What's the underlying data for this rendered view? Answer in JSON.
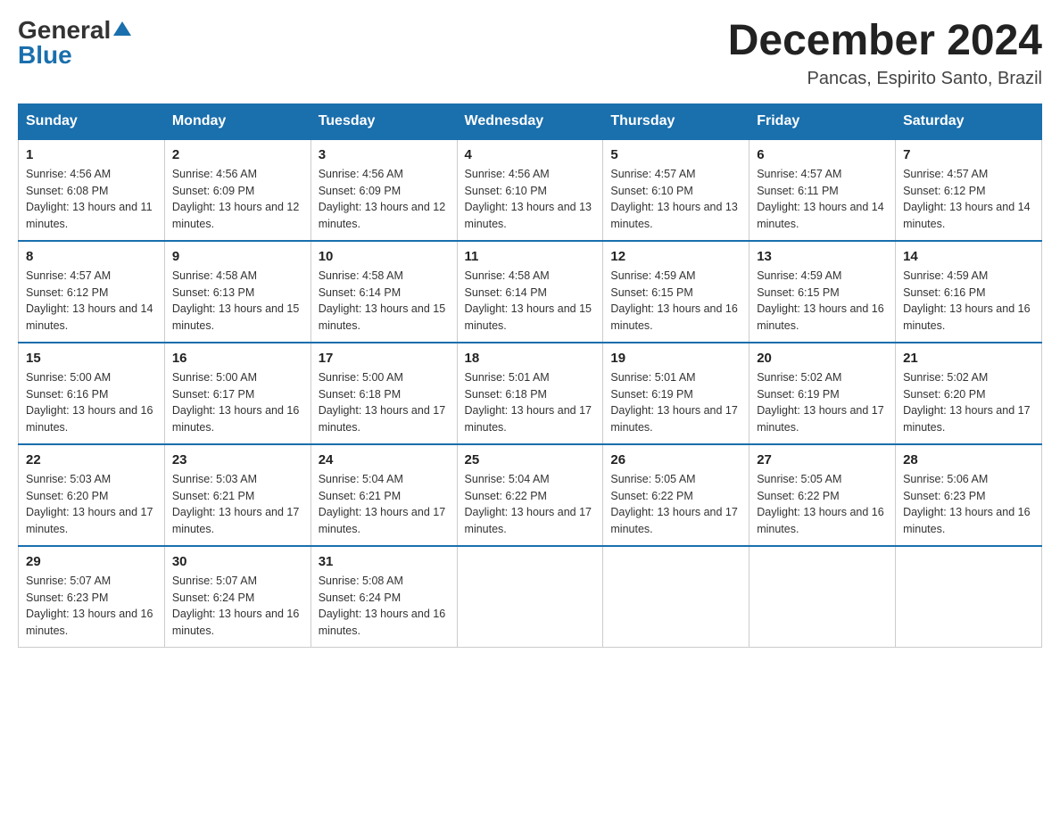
{
  "logo": {
    "general": "General",
    "triangle": "▲",
    "blue": "Blue"
  },
  "title": "December 2024",
  "subtitle": "Pancas, Espirito Santo, Brazil",
  "weekdays": [
    "Sunday",
    "Monday",
    "Tuesday",
    "Wednesday",
    "Thursday",
    "Friday",
    "Saturday"
  ],
  "weeks": [
    [
      {
        "day": "1",
        "sunrise": "4:56 AM",
        "sunset": "6:08 PM",
        "daylight": "13 hours and 11 minutes."
      },
      {
        "day": "2",
        "sunrise": "4:56 AM",
        "sunset": "6:09 PM",
        "daylight": "13 hours and 12 minutes."
      },
      {
        "day": "3",
        "sunrise": "4:56 AM",
        "sunset": "6:09 PM",
        "daylight": "13 hours and 12 minutes."
      },
      {
        "day": "4",
        "sunrise": "4:56 AM",
        "sunset": "6:10 PM",
        "daylight": "13 hours and 13 minutes."
      },
      {
        "day": "5",
        "sunrise": "4:57 AM",
        "sunset": "6:10 PM",
        "daylight": "13 hours and 13 minutes."
      },
      {
        "day": "6",
        "sunrise": "4:57 AM",
        "sunset": "6:11 PM",
        "daylight": "13 hours and 14 minutes."
      },
      {
        "day": "7",
        "sunrise": "4:57 AM",
        "sunset": "6:12 PM",
        "daylight": "13 hours and 14 minutes."
      }
    ],
    [
      {
        "day": "8",
        "sunrise": "4:57 AM",
        "sunset": "6:12 PM",
        "daylight": "13 hours and 14 minutes."
      },
      {
        "day": "9",
        "sunrise": "4:58 AM",
        "sunset": "6:13 PM",
        "daylight": "13 hours and 15 minutes."
      },
      {
        "day": "10",
        "sunrise": "4:58 AM",
        "sunset": "6:14 PM",
        "daylight": "13 hours and 15 minutes."
      },
      {
        "day": "11",
        "sunrise": "4:58 AM",
        "sunset": "6:14 PM",
        "daylight": "13 hours and 15 minutes."
      },
      {
        "day": "12",
        "sunrise": "4:59 AM",
        "sunset": "6:15 PM",
        "daylight": "13 hours and 16 minutes."
      },
      {
        "day": "13",
        "sunrise": "4:59 AM",
        "sunset": "6:15 PM",
        "daylight": "13 hours and 16 minutes."
      },
      {
        "day": "14",
        "sunrise": "4:59 AM",
        "sunset": "6:16 PM",
        "daylight": "13 hours and 16 minutes."
      }
    ],
    [
      {
        "day": "15",
        "sunrise": "5:00 AM",
        "sunset": "6:16 PM",
        "daylight": "13 hours and 16 minutes."
      },
      {
        "day": "16",
        "sunrise": "5:00 AM",
        "sunset": "6:17 PM",
        "daylight": "13 hours and 16 minutes."
      },
      {
        "day": "17",
        "sunrise": "5:00 AM",
        "sunset": "6:18 PM",
        "daylight": "13 hours and 17 minutes."
      },
      {
        "day": "18",
        "sunrise": "5:01 AM",
        "sunset": "6:18 PM",
        "daylight": "13 hours and 17 minutes."
      },
      {
        "day": "19",
        "sunrise": "5:01 AM",
        "sunset": "6:19 PM",
        "daylight": "13 hours and 17 minutes."
      },
      {
        "day": "20",
        "sunrise": "5:02 AM",
        "sunset": "6:19 PM",
        "daylight": "13 hours and 17 minutes."
      },
      {
        "day": "21",
        "sunrise": "5:02 AM",
        "sunset": "6:20 PM",
        "daylight": "13 hours and 17 minutes."
      }
    ],
    [
      {
        "day": "22",
        "sunrise": "5:03 AM",
        "sunset": "6:20 PM",
        "daylight": "13 hours and 17 minutes."
      },
      {
        "day": "23",
        "sunrise": "5:03 AM",
        "sunset": "6:21 PM",
        "daylight": "13 hours and 17 minutes."
      },
      {
        "day": "24",
        "sunrise": "5:04 AM",
        "sunset": "6:21 PM",
        "daylight": "13 hours and 17 minutes."
      },
      {
        "day": "25",
        "sunrise": "5:04 AM",
        "sunset": "6:22 PM",
        "daylight": "13 hours and 17 minutes."
      },
      {
        "day": "26",
        "sunrise": "5:05 AM",
        "sunset": "6:22 PM",
        "daylight": "13 hours and 17 minutes."
      },
      {
        "day": "27",
        "sunrise": "5:05 AM",
        "sunset": "6:22 PM",
        "daylight": "13 hours and 16 minutes."
      },
      {
        "day": "28",
        "sunrise": "5:06 AM",
        "sunset": "6:23 PM",
        "daylight": "13 hours and 16 minutes."
      }
    ],
    [
      {
        "day": "29",
        "sunrise": "5:07 AM",
        "sunset": "6:23 PM",
        "daylight": "13 hours and 16 minutes."
      },
      {
        "day": "30",
        "sunrise": "5:07 AM",
        "sunset": "6:24 PM",
        "daylight": "13 hours and 16 minutes."
      },
      {
        "day": "31",
        "sunrise": "5:08 AM",
        "sunset": "6:24 PM",
        "daylight": "13 hours and 16 minutes."
      },
      null,
      null,
      null,
      null
    ]
  ]
}
